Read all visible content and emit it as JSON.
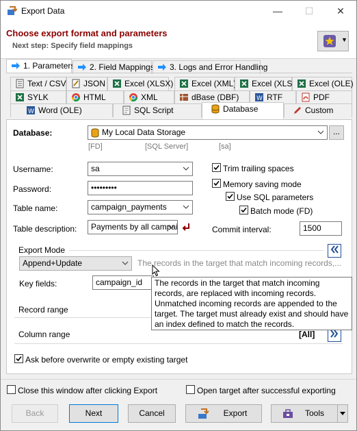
{
  "window": {
    "title": "Export Data",
    "minimize": "—",
    "maximize": "☐",
    "close": "✕"
  },
  "header": {
    "title": "Choose export format and parameters",
    "subtitle": "Next step: Specify field mappings"
  },
  "steps": [
    {
      "label": "1. Parameters"
    },
    {
      "label": "2. Field Mappings"
    },
    {
      "label": "3. Logs and Error Handling"
    }
  ],
  "formats": {
    "row1": [
      "Text / CSV",
      "JSON",
      "Excel (XLSX)",
      "Excel (XML)",
      "Excel (XLS)",
      "Excel (OLE)"
    ],
    "row2": [
      "SYLK",
      "HTML",
      "XML",
      "dBase (DBF)",
      "RTF",
      "PDF"
    ],
    "row3": [
      "Word (OLE)",
      "SQL Script",
      "Database",
      "Custom"
    ]
  },
  "database": {
    "label": "Database:",
    "value": "My Local Data Storage",
    "more": "...",
    "hint_fd": "[FD]",
    "hint_server": "[SQL Server]",
    "hint_user": "[sa]"
  },
  "fields": {
    "username_label": "Username:",
    "username": "sa",
    "password_label": "Password:",
    "password": "•••••••••",
    "table_label": "Table name:",
    "table": "campaign_payments",
    "desc_label": "Table description:",
    "desc": "Payments by all campai",
    "commit_label": "Commit interval:",
    "commit": "1500"
  },
  "options": {
    "trim": "Trim trailing spaces",
    "memory": "Memory saving mode",
    "sqlparams": "Use SQL parameters",
    "batch": "Batch mode (FD)"
  },
  "export_mode": {
    "group": "Export Mode",
    "value": "Append+Update",
    "hint": "The records in the target that match incoming records,...",
    "key_label": "Key fields:",
    "key_value": "campaign_id"
  },
  "ranges": {
    "record": "Record range",
    "column": "Column range",
    "column_value": "[All]"
  },
  "ask": "Ask before overwrite or empty existing target",
  "tooltip": "The records in the target that match incoming records, are replaced with incoming records. Unmatched incoming records are appended to the target. The target must already exist and should have an index defined to match the records.",
  "footer": {
    "close_after": "Close this window after clicking Export",
    "open_target": "Open target after successful exporting",
    "back": "Back",
    "next": "Next",
    "cancel": "Cancel",
    "export": "Export",
    "tools": "Tools"
  },
  "colors": {
    "accent": "#8b0000",
    "link": "#1f4e99",
    "star": "#f2c200"
  }
}
